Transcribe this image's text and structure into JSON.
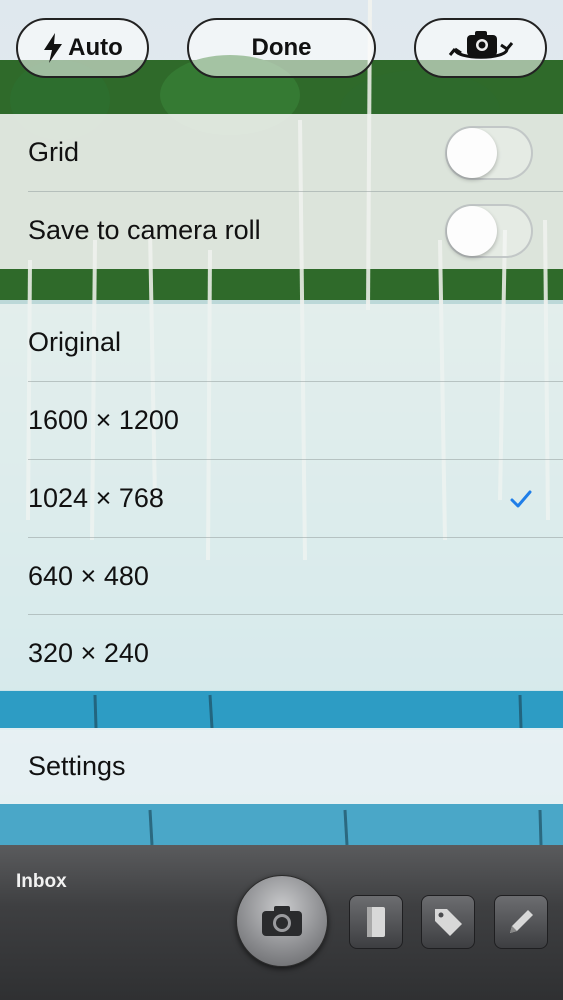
{
  "top_bar": {
    "flash_label": "Auto",
    "done_label": "Done"
  },
  "toggles": [
    {
      "label": "Grid",
      "on": false
    },
    {
      "label": "Save to camera roll",
      "on": false
    }
  ],
  "sizes": {
    "options": [
      "Original",
      "1600 × 1200",
      "1024 × 768",
      "640 × 480",
      "320 × 240"
    ],
    "selected": "1024 × 768"
  },
  "settings": {
    "label": "Settings"
  },
  "toolbar": {
    "inbox_label": "Inbox"
  },
  "icons": {
    "flash": "lightning-bolt-icon",
    "switch_camera": "camera-rotate-icon",
    "selected": "checkmark-icon",
    "shutter": "camera-icon",
    "notebook": "notebook-icon",
    "tag": "tag-icon",
    "edit": "pencil-icon"
  },
  "colors": {
    "accent": "#1f7ee8",
    "toolbar": "#3e3f41"
  }
}
